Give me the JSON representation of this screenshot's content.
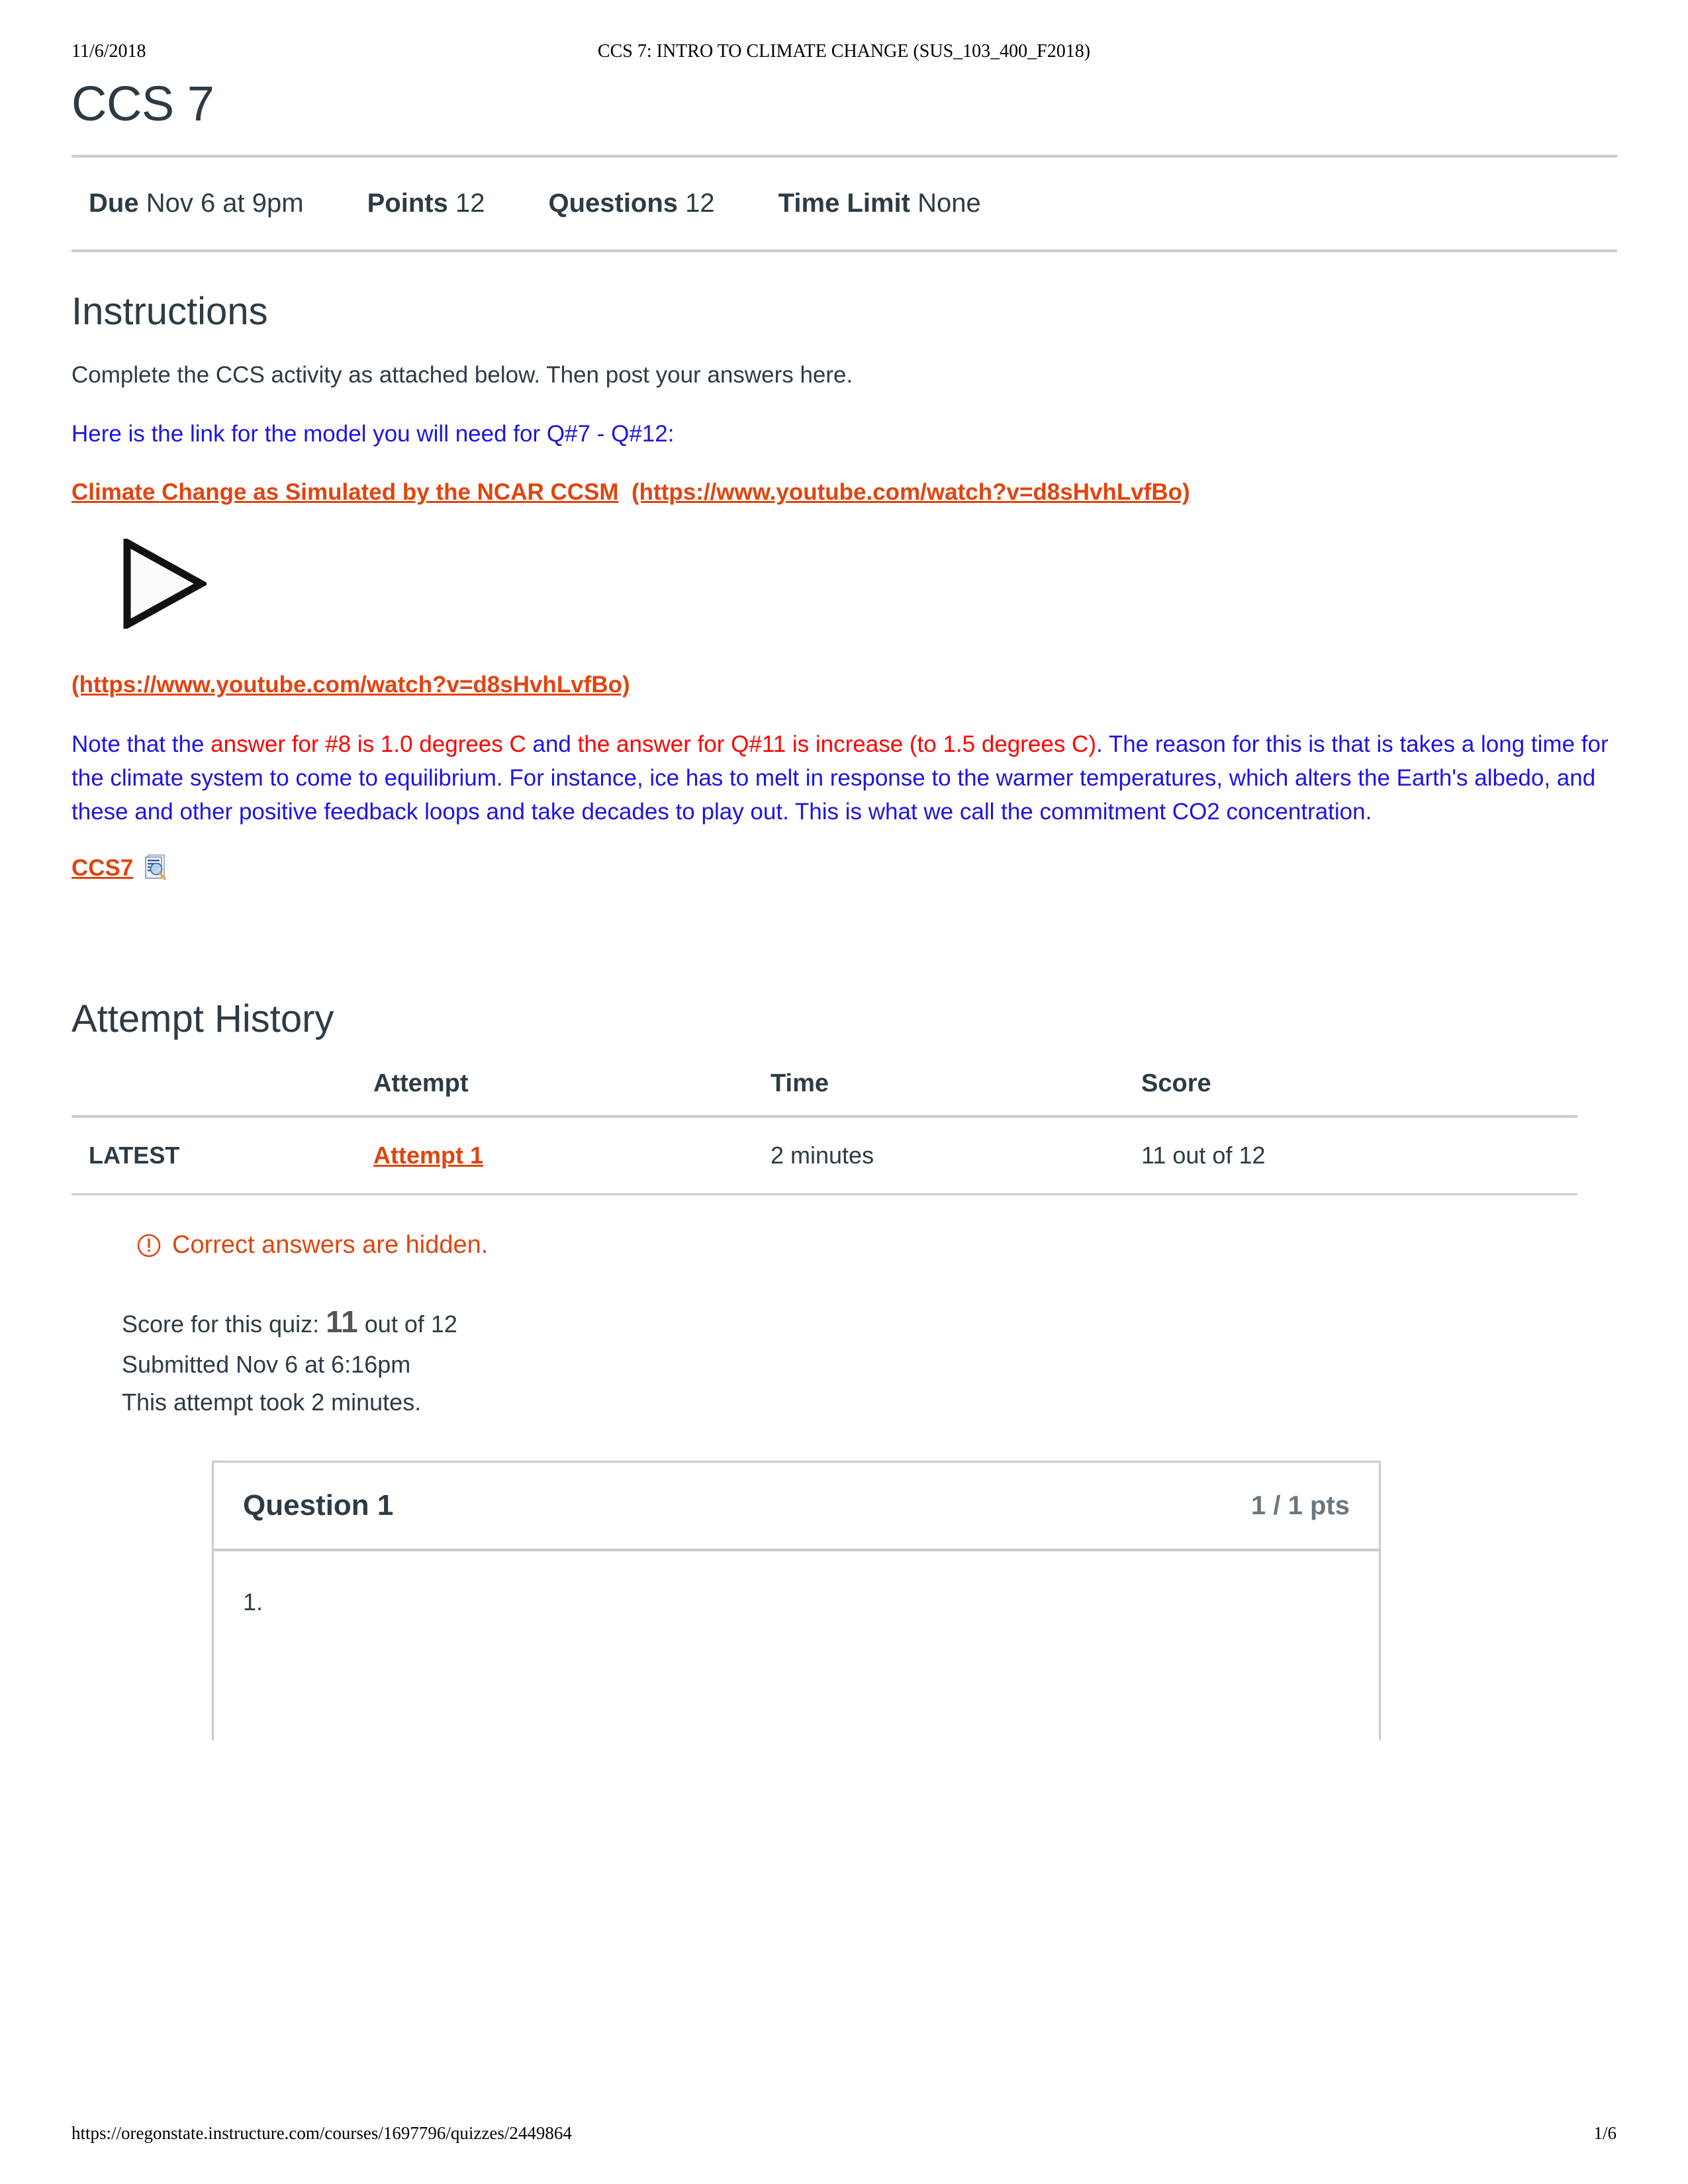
{
  "print": {
    "date": "11/6/2018",
    "course_title": "CCS 7: INTRO TO CLIMATE CHANGE (SUS_103_400_F2018)",
    "footer_url": "https://oregonstate.instructure.com/courses/1697796/quizzes/2449864",
    "page_number": "1/6"
  },
  "quiz": {
    "title": "CCS 7",
    "details": [
      {
        "label": "Due",
        "value": "Nov 6 at 9pm"
      },
      {
        "label": "Points",
        "value": "12"
      },
      {
        "label": "Questions",
        "value": "12"
      },
      {
        "label": "Time Limit",
        "value": "None"
      }
    ]
  },
  "instructions": {
    "heading": "Instructions",
    "p1": "Complete the CCS activity as attached below.  Then post your answers here.",
    "p2_blue": "Here is the link for the model you will need for Q#7 - Q#12:",
    "video_link_text": "Climate Change as Simulated by the NCAR CCSM",
    "video_link_url_text": "(https://www.youtube.com/watch?v=d8sHvhLvfBo)",
    "video_url_repeat": "(https://www.youtube.com/watch?v=d8sHvhLvfBo)",
    "note": {
      "seg1_blue": "Note that the ",
      "seg2_red": "answer for #8 is 1.0 degrees C",
      "seg3_blue": " and ",
      "seg4_red": "the answer for Q#11 is increase (to 1.5 degrees C)",
      "seg5_blue": ".  The reason for this is that is takes a long time for the climate system to come to equilibrium.  For instance, ice has to melt in response to the warmer temperatures, which alters the Earth's albedo, and these and other positive feedback loops and take decades to play out.  This is what we call the commitment CO2 concentration."
    },
    "attachment_label": "CCS7",
    "attachment_icon": "document-preview-icon",
    "play_icon": "play-triangle-icon"
  },
  "attempt_history": {
    "heading": "Attempt History",
    "columns": [
      "",
      "Attempt",
      "Time",
      "Score"
    ],
    "rows": [
      {
        "kept": "LATEST",
        "attempt": "Attempt 1 ",
        "time": "2 minutes",
        "score": "11 out of 12"
      }
    ]
  },
  "results": {
    "hidden_answers_icon": "warning-circle-icon",
    "hidden_answers_text": "Correct answers are hidden.",
    "score_prefix": "Score for this quiz: ",
    "score_value": "11",
    "score_suffix": " out of 12",
    "submitted": "Submitted Nov 6 at 6:16pm",
    "duration": "This attempt took 2 minutes."
  },
  "question": {
    "name": "Question 1",
    "points": "1 / 1 pts",
    "body": "1."
  },
  "colors": {
    "link_orange": "#e0450f",
    "blue_text": "#1d14e4",
    "red_text": "#ff0000",
    "rule_gray": "#c7cdd1",
    "body_text": "#2d3b45",
    "muted_gray": "#6b7780"
  }
}
